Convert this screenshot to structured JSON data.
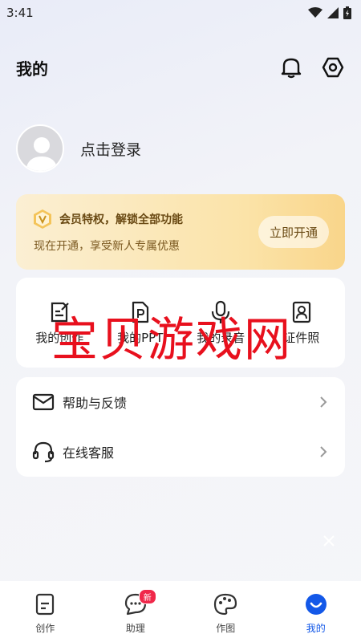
{
  "status": {
    "time": "3:41"
  },
  "header": {
    "title": "我的"
  },
  "profile": {
    "login_text": "点击登录"
  },
  "vip": {
    "title": "会员特权，解锁全部功能",
    "subtitle": "现在开通，享受新人专属优惠",
    "button": "立即开通"
  },
  "tools": [
    {
      "label": "我的创作",
      "icon": "edit-doc-icon"
    },
    {
      "label": "我的PPT",
      "icon": "ppt-file-icon"
    },
    {
      "label": "我的录音",
      "icon": "microphone-icon"
    },
    {
      "label": "证件照",
      "icon": "id-photo-icon"
    }
  ],
  "watermark": "宝贝游戏网",
  "menu": [
    {
      "label": "帮助与反馈",
      "icon": "mail-icon"
    },
    {
      "label": "在线客服",
      "icon": "headset-icon"
    }
  ],
  "tabs": [
    {
      "label": "创作",
      "icon": "document-icon",
      "active": false
    },
    {
      "label": "助理",
      "icon": "chat-bubble-icon",
      "active": false,
      "badge": "新"
    },
    {
      "label": "作图",
      "icon": "palette-icon",
      "active": false
    },
    {
      "label": "我的",
      "icon": "profile-smile-icon",
      "active": true
    }
  ],
  "colors": {
    "accent": "#1358e8",
    "badge": "#f0284a",
    "watermark": "#e8101d",
    "vip_text": "#6a4a14"
  }
}
